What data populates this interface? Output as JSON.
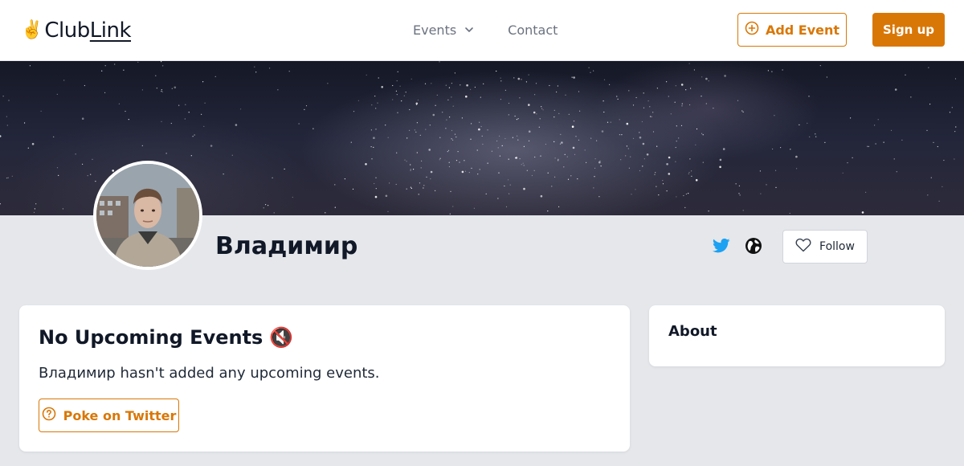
{
  "header": {
    "logo_hand": "✌️",
    "logo_word_a": "Club",
    "logo_word_b": "Link",
    "nav": [
      {
        "label": "Events",
        "has_dropdown": true
      },
      {
        "label": "Contact",
        "has_dropdown": false
      }
    ],
    "add_event_label": "Add Event",
    "signup_label": "Sign up"
  },
  "profile": {
    "name": "Владимир",
    "social_icons": [
      "twitter-icon",
      "globe-icon"
    ],
    "follow_label": "Follow"
  },
  "events_card": {
    "title": "No Upcoming Events",
    "title_emoji": "🔇",
    "message": "Владимир hasn't added any upcoming events.",
    "poke_label": "Poke on Twitter"
  },
  "about_card": {
    "title": "About"
  },
  "colors": {
    "accent": "#d97706",
    "twitter": "#1da1f2",
    "page_bg": "#e5e7eb"
  }
}
